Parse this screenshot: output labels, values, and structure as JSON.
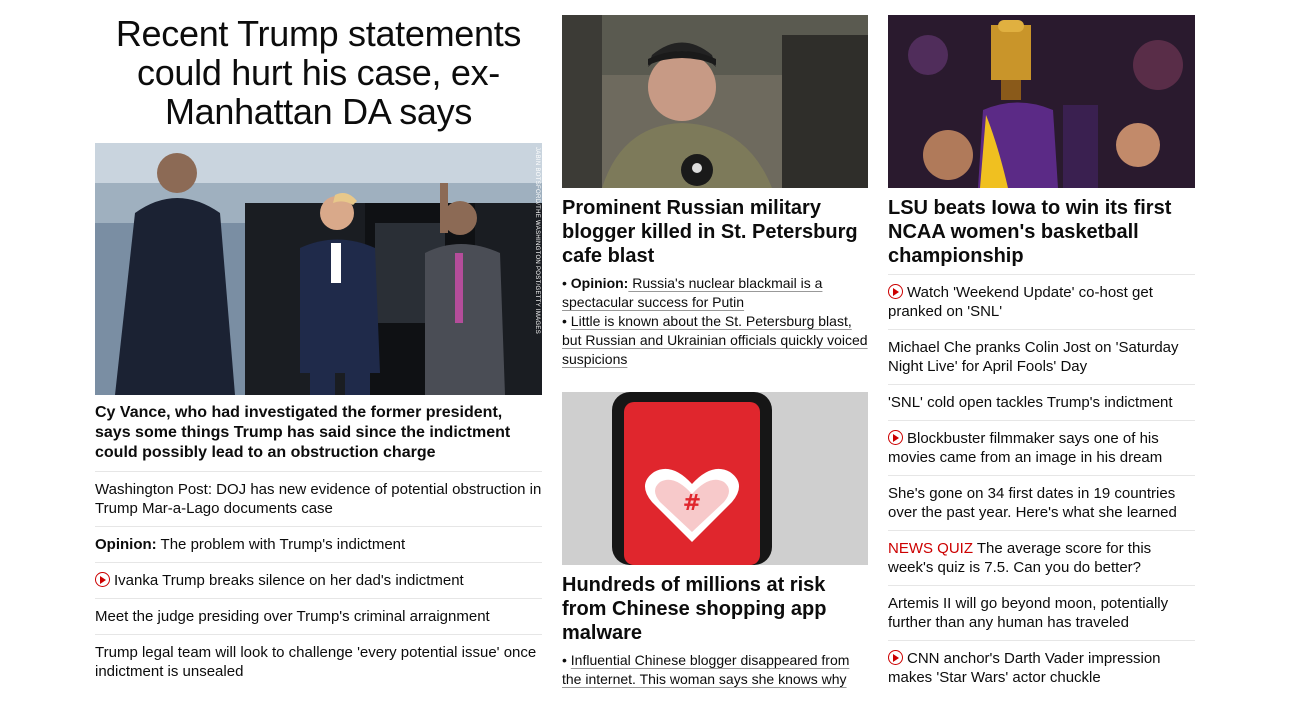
{
  "left": {
    "headline": "Recent Trump statements could hurt his case, ex-Manhattan DA says",
    "image_credit": "JABIN BOTSFORD/THE WASHINGTON POST/GETTY IMAGES",
    "subhead": "Cy Vance, who had investigated the former president, says some things Trump has said since the indictment could possibly lead to an obstruction charge",
    "links": [
      {
        "label": "",
        "text": "Washington Post: DOJ has new evidence of potential obstruction in Trump Mar-a-Lago documents case",
        "video": false
      },
      {
        "label": "Opinion:",
        "text": " The problem with Trump's indictment",
        "video": false
      },
      {
        "label": "",
        "text": "Ivanka Trump breaks silence on her dad's indictment",
        "video": true
      },
      {
        "label": "",
        "text": "Meet the judge presiding over Trump's criminal arraignment",
        "video": false
      },
      {
        "label": "",
        "text": "Trump legal team will look to challenge 'every potential issue' once indictment is unsealed",
        "video": false
      }
    ]
  },
  "middle": {
    "card1": {
      "headline": "Prominent Russian military blogger killed in St. Petersburg cafe blast",
      "bullet1_label": "Opinion:",
      "bullet1_text": " Russia's nuclear blackmail is a spectacular success for Putin",
      "bullet2_text": "Little is known about the St. Petersburg blast, but Russian and Ukrainian officials quickly voiced suspicions"
    },
    "card2": {
      "headline": "Hundreds of millions at risk from Chinese shopping app malware",
      "bullet1_text": "Influential Chinese blogger disappeared from the internet. This woman says she knows why"
    }
  },
  "right": {
    "headline": "LSU beats Iowa to win its first NCAA women's basketball championship",
    "links": [
      {
        "text": "Watch 'Weekend Update' co-host get pranked on 'SNL'",
        "video": true
      },
      {
        "text": "Michael Che pranks Colin Jost on 'Saturday Night Live' for April Fools' Day",
        "video": false
      },
      {
        "text": "'SNL' cold open tackles Trump's indictment",
        "video": false
      },
      {
        "text": "Blockbuster filmmaker says one of his movies came from an image in his dream",
        "video": true
      },
      {
        "text": "She's gone on 34 first dates in 19 countries over the past year. Here's what she learned",
        "video": false
      },
      {
        "label": "NEWS QUIZ",
        "text": " The average score for this week's quiz is 7.5. Can you do better?",
        "video": false
      },
      {
        "text": "Artemis II will go beyond moon, potentially further than any human has traveled",
        "video": false
      },
      {
        "text": "CNN anchor's Darth Vader impression makes 'Star Wars' actor chuckle",
        "video": true
      }
    ]
  },
  "colors": {
    "accent_red": "#cc0000",
    "divider": "#e6e6e6",
    "text": "#0c0c0c"
  }
}
